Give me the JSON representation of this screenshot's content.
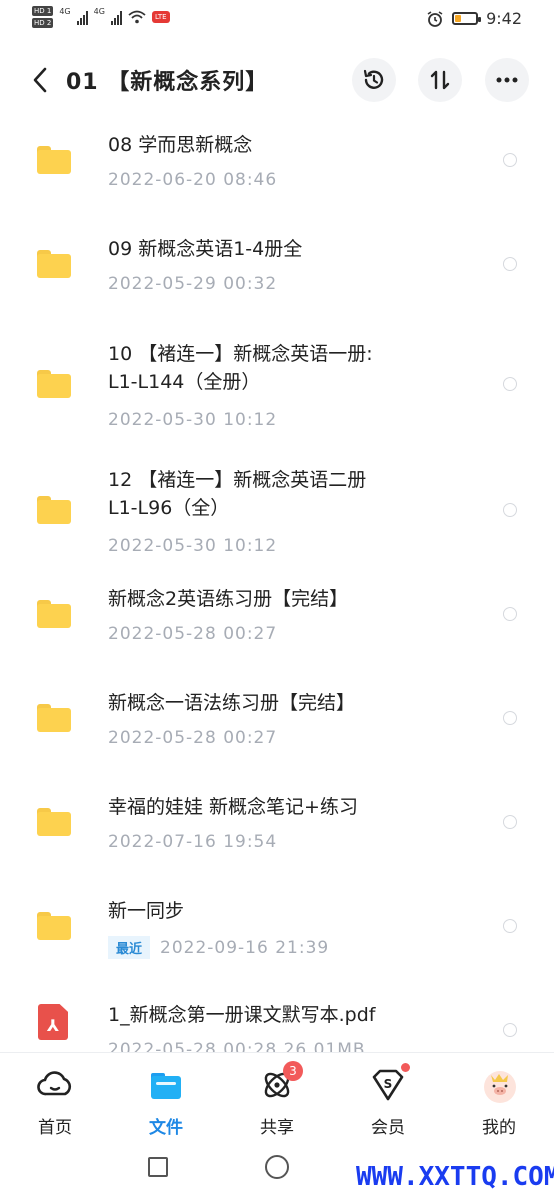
{
  "statusbar": {
    "sim1": "HD 1",
    "sim2": "HD 2",
    "net1": "4G",
    "net2": "4G",
    "app_badge": "LTE",
    "time": "9:42",
    "battery_level": 0.2
  },
  "header": {
    "title": "01 【新概念系列】",
    "icons": [
      "back-icon",
      "history-icon",
      "sort-icon",
      "more-icon"
    ]
  },
  "files": [
    {
      "type": "folder",
      "name": "08 学而思新概念",
      "date": "2022-06-20  08:46"
    },
    {
      "type": "folder",
      "name": "09 新概念英语1-4册全",
      "date": "2022-05-29  00:32"
    },
    {
      "type": "folder",
      "name": "10 【褚连一】新概念英语一册:L1-L144（全册）",
      "name_line1": "10 【褚连一】新概念英语一册:",
      "name_line2": "L1-L144（全册）",
      "date": "2022-05-30  10:12"
    },
    {
      "type": "folder",
      "name": "12 【褚连一】新概念英语二册L1-L96（全）",
      "name_line1": "12 【褚连一】新概念英语二册",
      "name_line2": "L1-L96（全）",
      "date": "2022-05-30  10:12"
    },
    {
      "type": "folder",
      "name": "新概念2英语练习册【完结】",
      "date": "2022-05-28  00:27"
    },
    {
      "type": "folder",
      "name": "新概念一语法练习册【完结】",
      "date": "2022-05-28  00:27"
    },
    {
      "type": "folder",
      "name": "幸福的娃娃 新概念笔记+练习",
      "date": "2022-07-16  19:54"
    },
    {
      "type": "folder",
      "name": "新一同步",
      "tag": "最近",
      "date": "2022-09-16  21:39"
    },
    {
      "type": "pdf",
      "name": "1_新概念第一册课文默写本.pdf",
      "date": "2022-05-28  00:28  26.01MB"
    }
  ],
  "bottom_nav": {
    "items": [
      {
        "label": "首页",
        "icon": "cloud-home-icon"
      },
      {
        "label": "文件",
        "icon": "folder-icon",
        "active": true
      },
      {
        "label": "共享",
        "icon": "share-orbit-icon",
        "badge": "3"
      },
      {
        "label": "会员",
        "icon": "vip-diamond-icon",
        "dot": true
      },
      {
        "label": "我的",
        "icon": "pig-avatar-icon"
      }
    ]
  },
  "watermark": "WWW.XXTTQ.COM",
  "colors": {
    "accent": "#1e88e5",
    "folder": "#fdd24f",
    "pdf": "#e8514b",
    "badge": "#f25a5a"
  }
}
